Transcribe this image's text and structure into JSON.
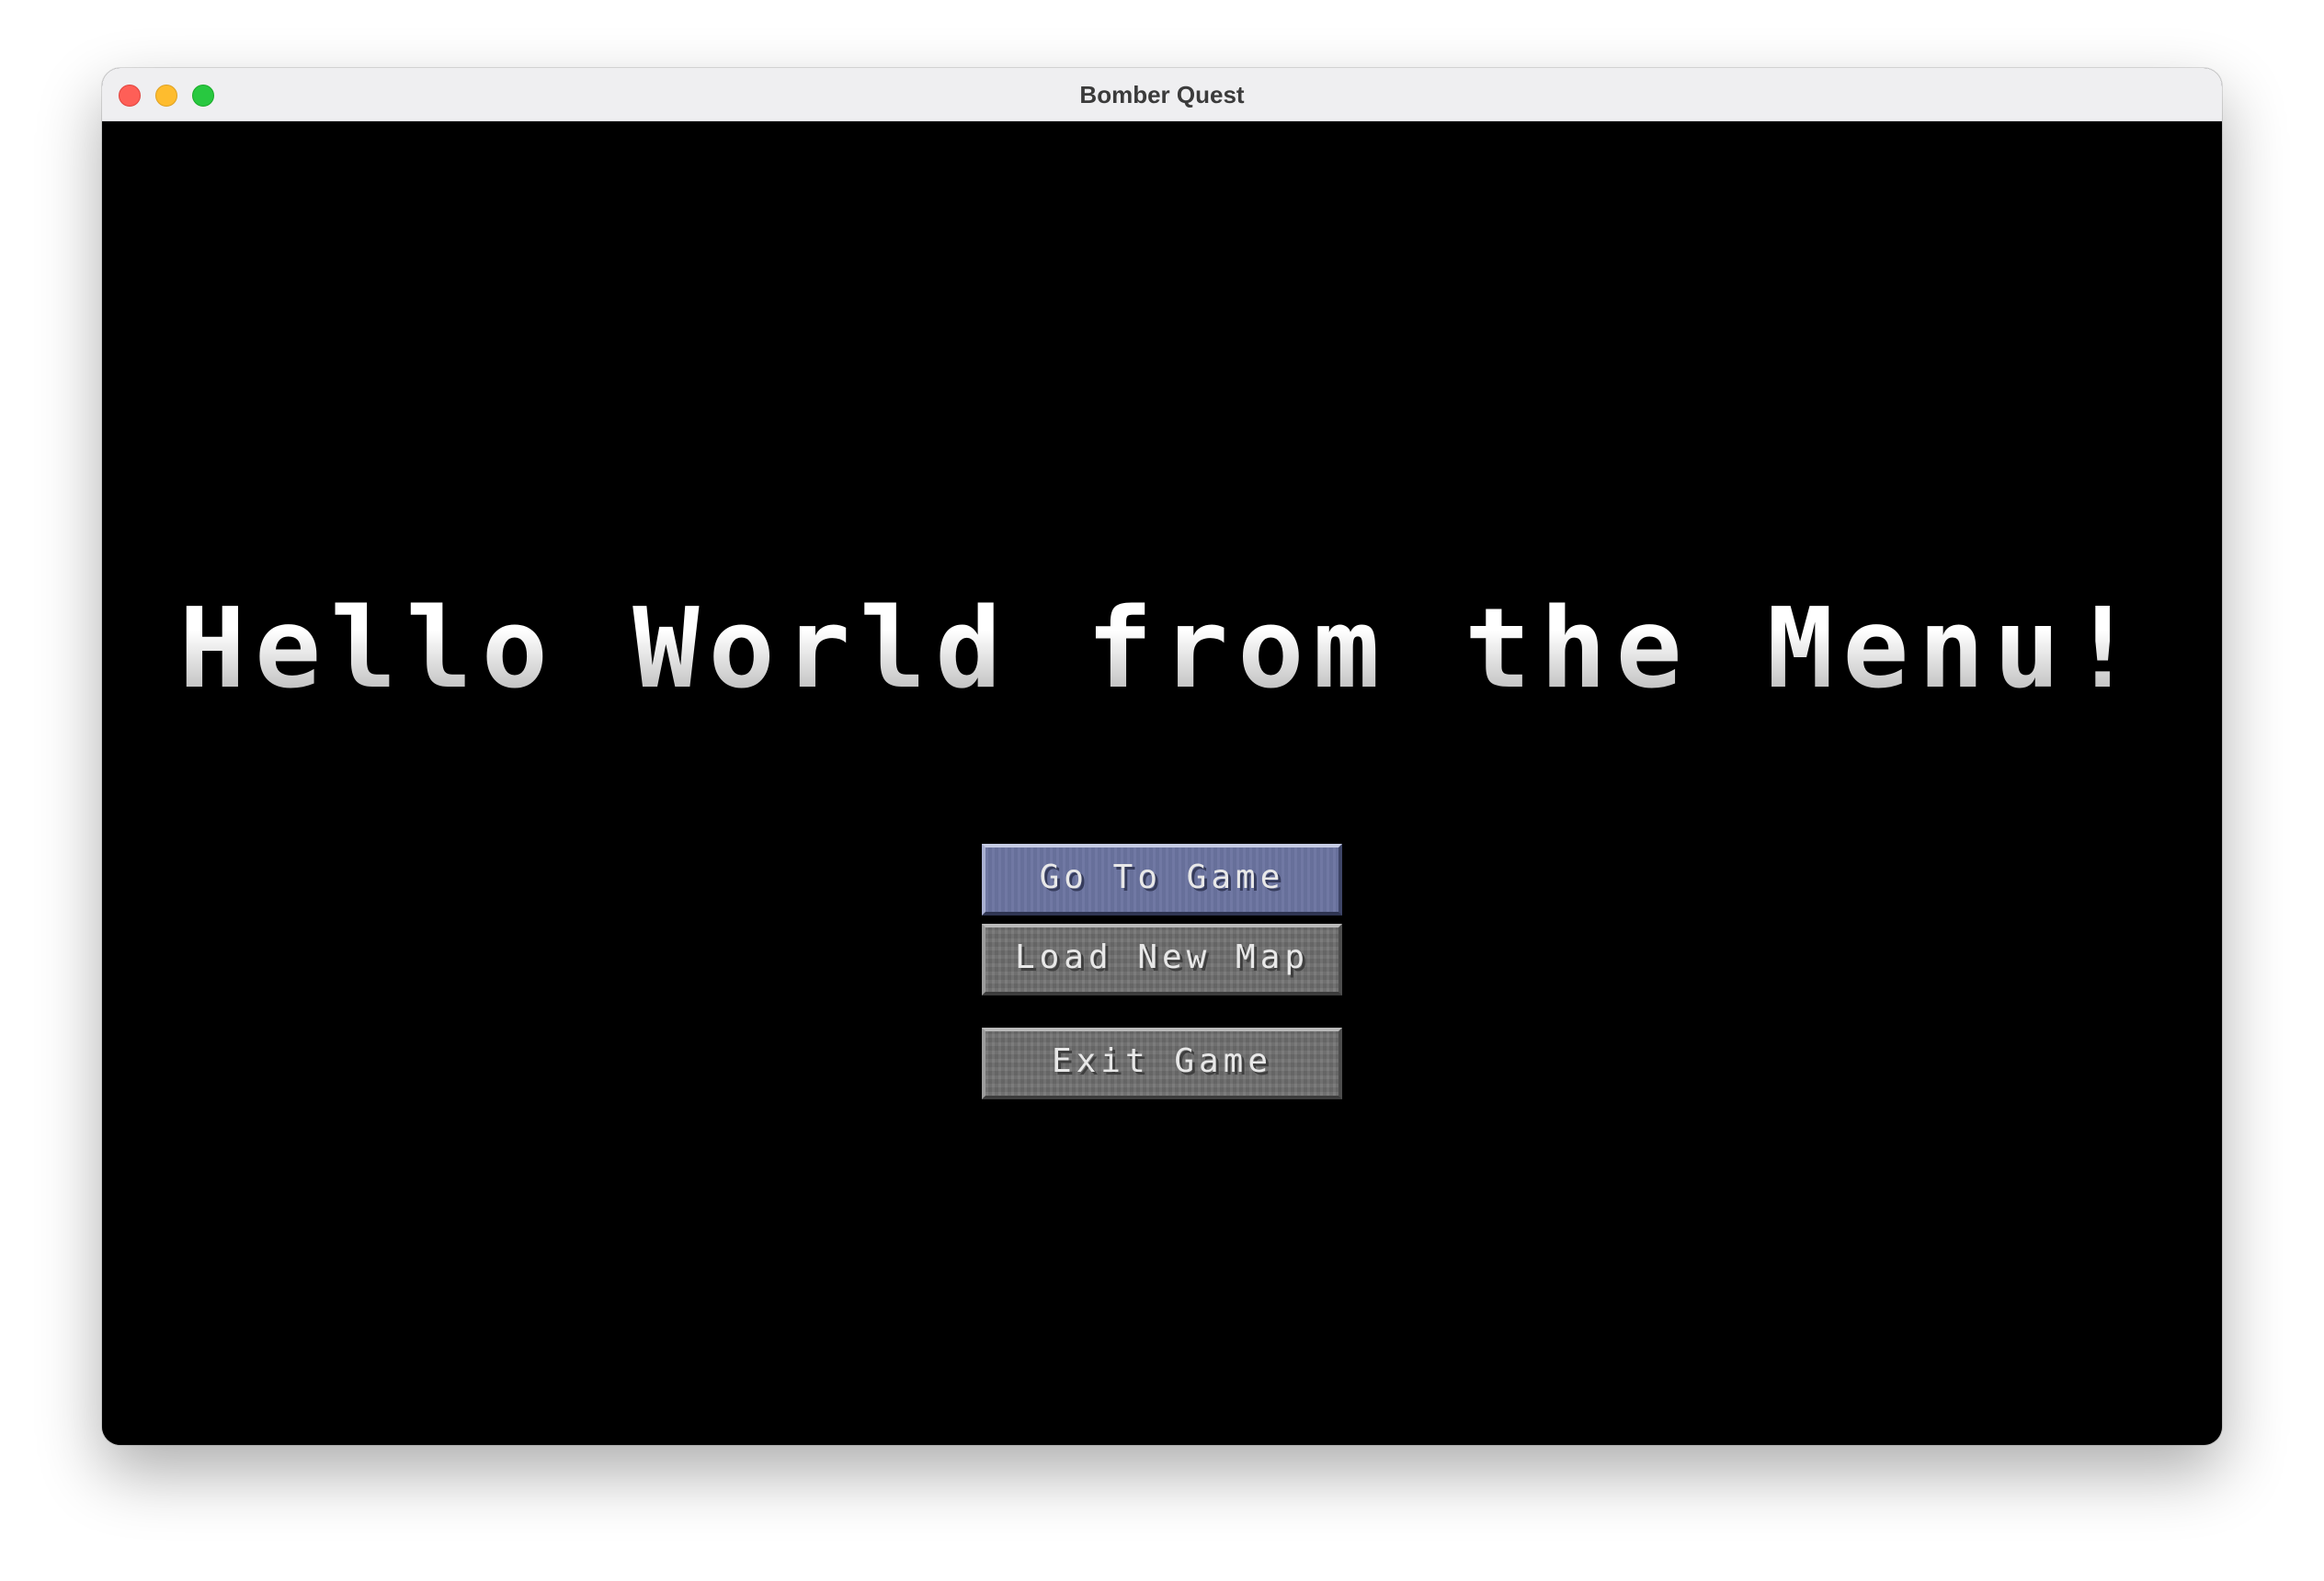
{
  "window": {
    "title": "Bomber Quest"
  },
  "menu": {
    "title": "Hello World from the Menu!",
    "buttons": [
      {
        "label": "Go To Game",
        "state": "selected"
      },
      {
        "label": "Load New Map",
        "state": "normal"
      },
      {
        "label": "Exit Game",
        "state": "normal"
      }
    ]
  },
  "colors": {
    "background": "#000000",
    "button_selected": "#6a739f",
    "button_normal": "#6f6f6f",
    "title_text": "#e6e6e6"
  }
}
